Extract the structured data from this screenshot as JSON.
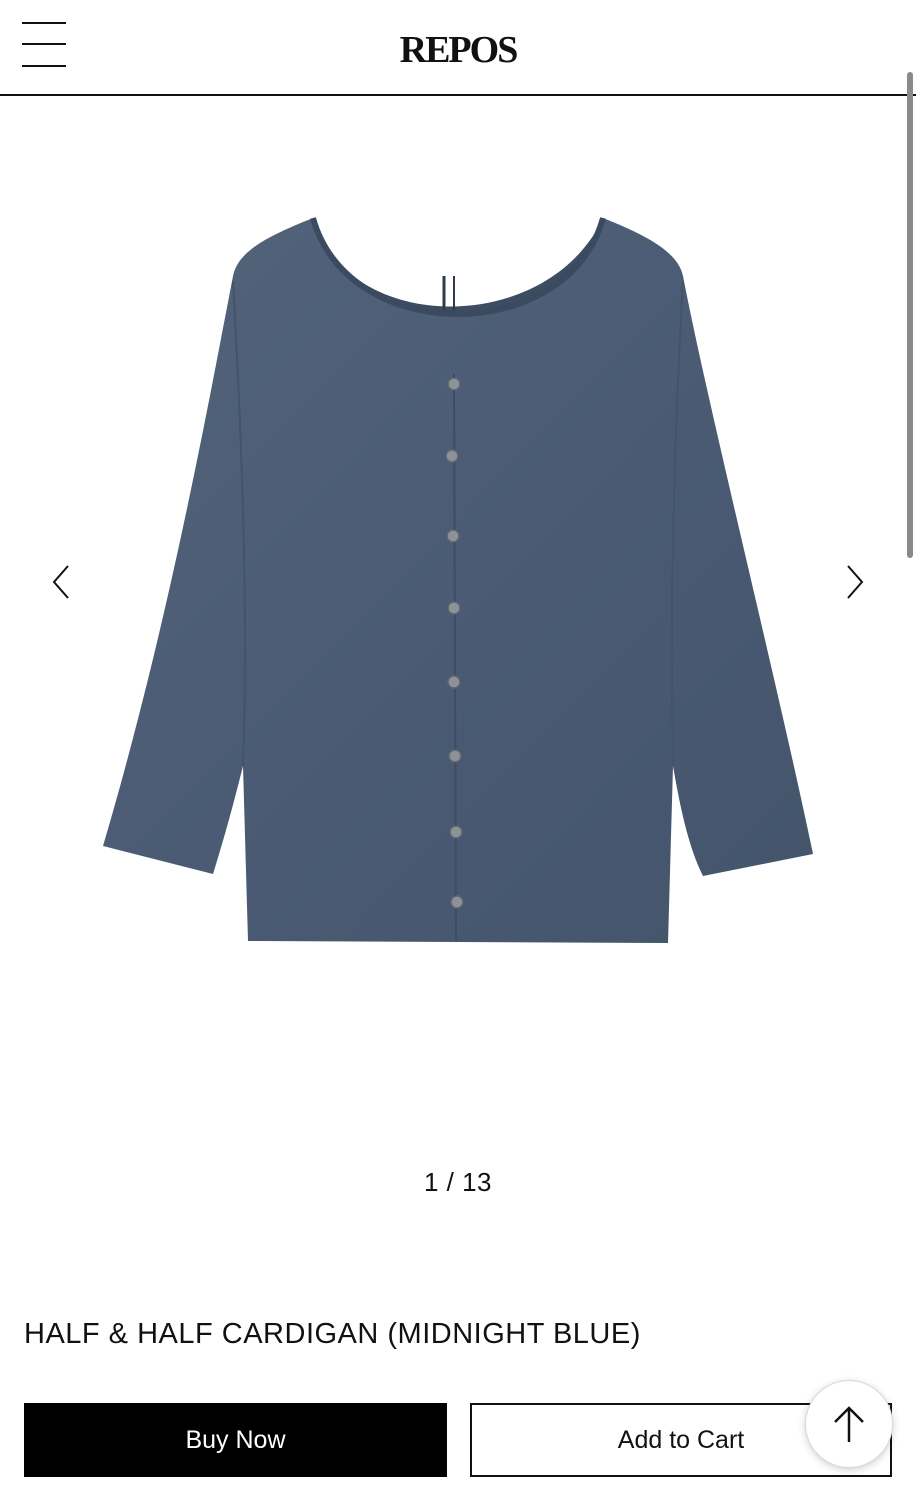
{
  "header": {
    "brand": "REPOS",
    "menu_icon": "hamburger-menu-icon"
  },
  "gallery": {
    "counter": "1 / 13",
    "prev_icon": "chevron-left-icon",
    "next_icon": "chevron-right-icon",
    "image": "product-photo-cardigan"
  },
  "product": {
    "title": "HALF & HALF CARDIGAN (MIDNIGHT BLUE)",
    "color": "#4a5b73"
  },
  "actions": {
    "buy_now": "Buy Now",
    "add_to_cart": "Add to Cart",
    "scroll_top_icon": "arrow-up-icon"
  }
}
